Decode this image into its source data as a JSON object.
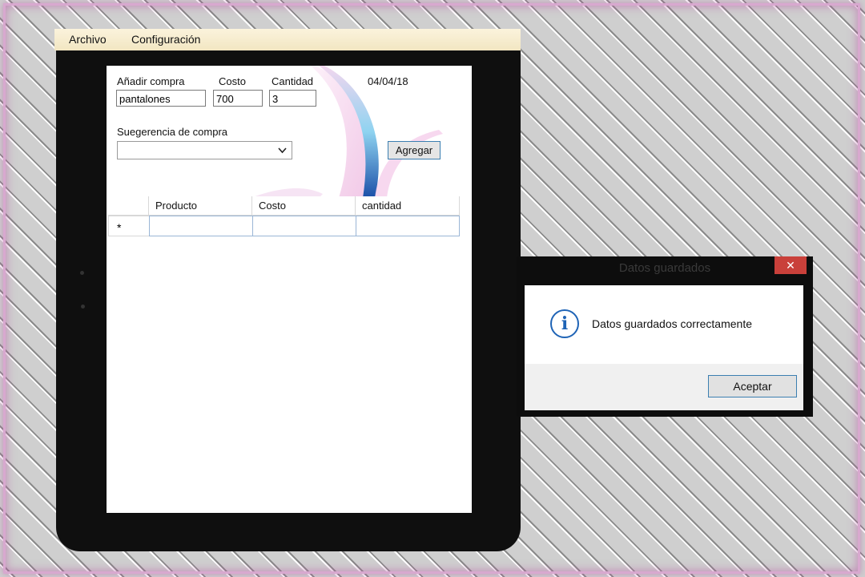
{
  "menu": {
    "items": [
      "Archivo",
      "Configuración"
    ]
  },
  "form": {
    "add_label": "Añadir compra",
    "cost_label": "Costo",
    "qty_label": "Cantidad",
    "date": "04/04/18",
    "product_value": "pantalones",
    "cost_value": "700",
    "qty_value": "3",
    "suggest_label": "Suegerencia de compra",
    "suggest_value": "",
    "add_button": "Agregar"
  },
  "grid": {
    "columns": [
      "Producto",
      "Costo",
      "cantidad"
    ],
    "new_row_marker": "*"
  },
  "dialog": {
    "title": "Datos guardados",
    "close_glyph": "✕",
    "icon": "info-icon",
    "icon_glyph": "i",
    "message": "Datos guardados correctamente",
    "ok_button": "Aceptar"
  }
}
